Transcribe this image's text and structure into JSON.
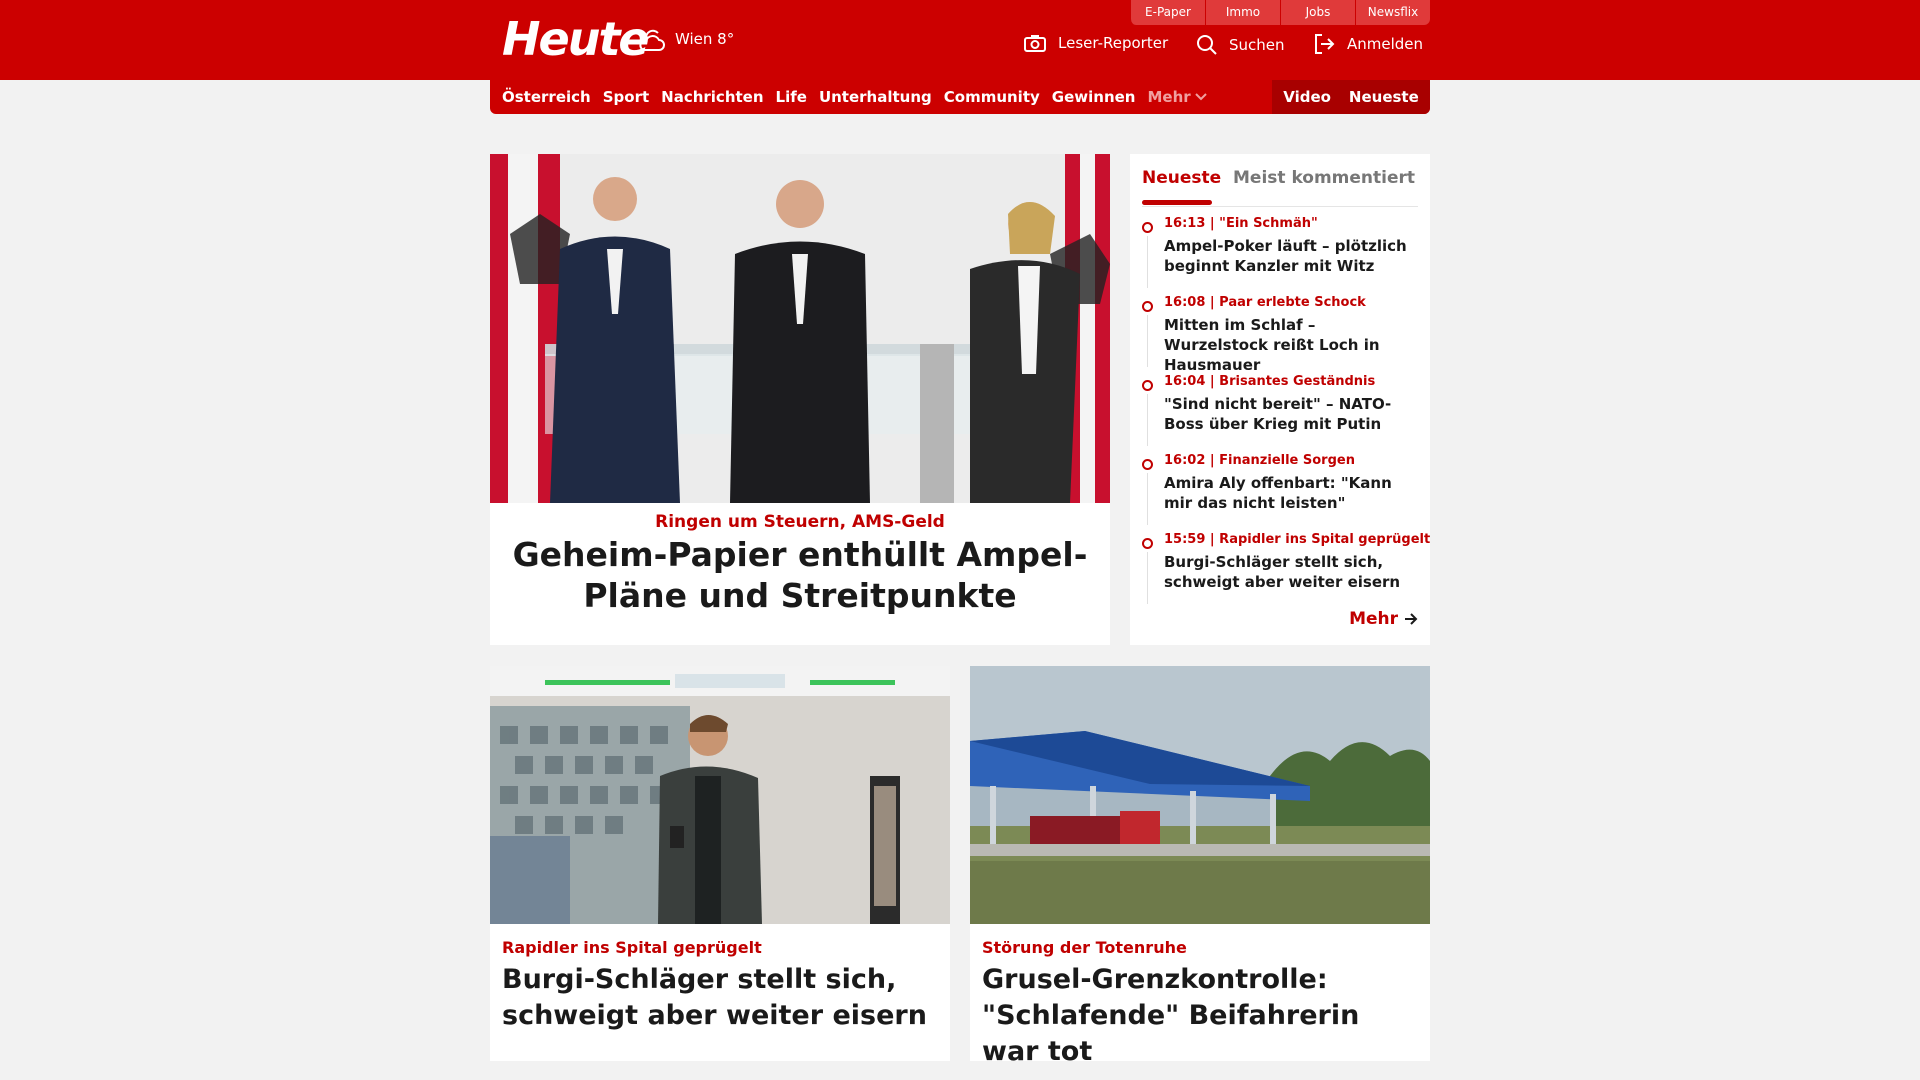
{
  "header": {
    "logo": "Heute",
    "weather": "Wien 8°",
    "service_tabs": [
      "E-Paper",
      "Immo",
      "Jobs",
      "Newsflix"
    ],
    "actions": {
      "leser_reporter": "Leser-Reporter",
      "suchen": "Suchen",
      "anmelden": "Anmelden"
    }
  },
  "nav": {
    "items": [
      "Österreich",
      "Sport",
      "Nachrichten",
      "Life",
      "Unterhaltung",
      "Community",
      "Gewinnen"
    ],
    "more": "Mehr",
    "video": "Video",
    "neueste": "Neueste"
  },
  "lead": {
    "kicker": "Ringen um Steuern, AMS-Geld",
    "title": "Geheim-Papier enthüllt Ampel-Pläne und Streitpunkte"
  },
  "sidebar": {
    "tabs": [
      "Neueste",
      "Meist kommentiert"
    ],
    "items": [
      {
        "meta": "16:13 | \"Ein Schmäh\"",
        "title": "Ampel-Poker läuft – plötzlich beginnt Kanzler mit Witz"
      },
      {
        "meta": "16:08 | Paar erlebte Schock",
        "title": "Mitten im Schlaf – Wurzelstock reißt Loch in Hausmauer"
      },
      {
        "meta": "16:04 | Brisantes Geständnis",
        "title": "\"Sind nicht bereit\" – NATO-Boss über Krieg mit Putin"
      },
      {
        "meta": "16:02 | Finanzielle Sorgen",
        "title": "Amira Aly offenbart: \"Kann mir das nicht leisten\""
      },
      {
        "meta": "15:59 | Rapidler ins Spital geprügelt",
        "title": "Burgi-Schläger stellt sich, schweigt aber weiter eisern"
      }
    ],
    "more": "Mehr"
  },
  "cards": [
    {
      "kicker": "Rapidler ins Spital geprügelt",
      "title": "Burgi-Schläger stellt sich, schweigt aber weiter eisern"
    },
    {
      "kicker": "Störung der Totenruhe",
      "title": "Grusel-Grenzkontrolle: \"Schlafende\" Beifahrerin war tot"
    }
  ],
  "colors": {
    "brand_red": "#cc0000",
    "dark_red": "#a80000",
    "kicker_red": "#c00000"
  }
}
